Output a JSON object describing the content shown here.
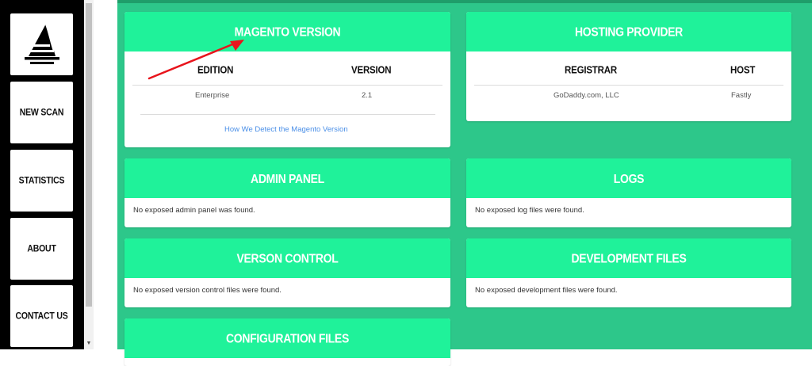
{
  "sidebar": {
    "items": [
      {
        "label": "NEW SCAN"
      },
      {
        "label": "STATISTICS"
      },
      {
        "label": "ABOUT"
      },
      {
        "label": "CONTACT US"
      }
    ]
  },
  "cards": {
    "magento_version": {
      "title": "MAGENTO VERSION",
      "columns": [
        "EDITION",
        "VERSION"
      ],
      "row": [
        "Enterprise",
        "2.1"
      ],
      "link": "How We Detect the Magento Version"
    },
    "hosting_provider": {
      "title": "HOSTING PROVIDER",
      "columns": [
        "REGISTRAR",
        "HOST"
      ],
      "row": [
        "GoDaddy.com, LLC",
        "Fastly"
      ]
    },
    "admin_panel": {
      "title": "ADMIN PANEL",
      "message": "No exposed admin panel was found."
    },
    "logs": {
      "title": "LOGS",
      "message": "No exposed log files were found."
    },
    "version_control": {
      "title": "VERSON CONTROL",
      "message": "No exposed version control files were found."
    },
    "development_files": {
      "title": "DEVELOPMENT FILES",
      "message": "No exposed development files were found."
    },
    "configuration_files": {
      "title": "CONFIGURATION FILES"
    }
  },
  "icons": {
    "logo": "wizard-hat-icon",
    "annotation": "red-arrow-icon"
  },
  "colors": {
    "sidebar": "#000000",
    "background": "#2dc78a",
    "card_header": "#1ff29a",
    "link": "#4a8fe7",
    "arrow": "#e8141c"
  }
}
